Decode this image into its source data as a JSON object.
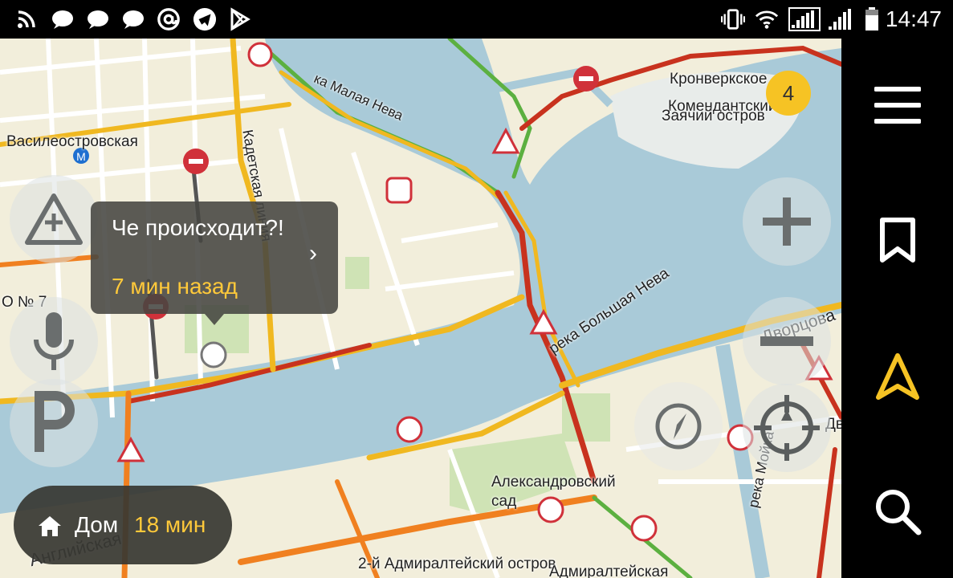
{
  "status_bar": {
    "time": "14:47",
    "left_icons": [
      "rss-icon",
      "chat-bubble-icon",
      "chat-bubble-icon",
      "chat-bubble-icon",
      "at-sign-icon",
      "telegram-icon",
      "play-store-icon"
    ],
    "right_icons": [
      "vibrate-icon",
      "wifi-icon",
      "signal-1-icon",
      "signal-2-icon",
      "battery-icon"
    ]
  },
  "map": {
    "labels": {
      "vasileostrovskaya": "Василеостровская",
      "malaya_neva": "ка Малая Нева",
      "kadetskaya": "Кадетская линия",
      "kronverkskoe": "Кронверкское",
      "komendantsky": "Комендантский",
      "zayachy": "Заячий остров",
      "bolshaya_neva": "река Большая Нева",
      "dvortsova": "Дворцова",
      "alexandrovsky": "Александровский",
      "sad": "сад",
      "moika": "река Мойка",
      "admiralteysky_2": "2-й Адмиралтейский остров",
      "admiralteyskaya": "Адмиралтейская",
      "angliyskaya": "Английская",
      "o7": "О № 7",
      "dv": "Дв"
    },
    "metro_icon": "metro-icon",
    "badge_count": "4"
  },
  "popup": {
    "title": "Че происходит?!",
    "time_ago": "7 мин назад",
    "chevron": "›"
  },
  "home_button": {
    "label": "Дом",
    "eta": "18 мин"
  },
  "controls": {
    "left": [
      "report-road-event-icon",
      "microphone-icon",
      "parking-icon"
    ],
    "right": [
      "zoom-in-icon",
      "zoom-out-icon",
      "locate-icon"
    ],
    "compass": "compass-icon"
  },
  "sidebar": [
    "menu-icon",
    "bookmark-icon",
    "navigation-arrow-icon",
    "search-icon"
  ],
  "colors": {
    "water": "#a9cad8",
    "land": "#f2eedb",
    "traffic_red": "#c8321e",
    "traffic_orange": "#f08020",
    "traffic_yellow": "#f0b820",
    "traffic_green": "#5cb040",
    "accent_yellow": "#ffc93a"
  }
}
